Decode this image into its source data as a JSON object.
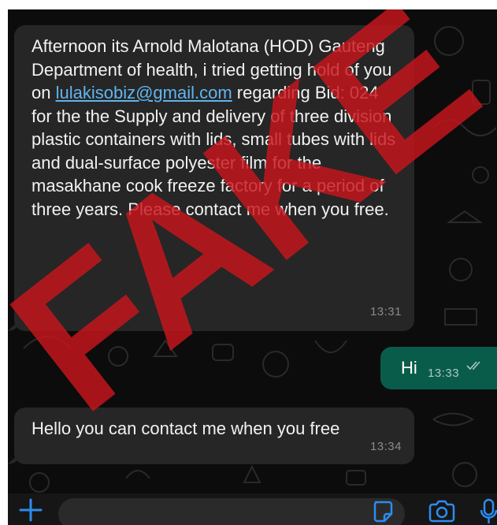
{
  "chat": {
    "messages": [
      {
        "direction": "incoming",
        "text_before_link": "Afternoon its Arnold Malotana (HOD) Gauteng Department of health, i tried getting hold of you on ",
        "link": "lulakisobiz@gmail.com",
        "text_after_link": " regarding Bid: 024 for the the Supply and delivery of three division plastic containers with lids, small tubes with lids and dual-surface polyester film for the masakhane cook freeze factory for a period of three years. Please contact me when you free.",
        "time": "13:31"
      },
      {
        "direction": "outgoing",
        "text": "Hi",
        "time": "13:33",
        "status_icon": "double-check-icon"
      },
      {
        "direction": "incoming",
        "text": "Hello you can contact me when you free",
        "time": "13:34"
      }
    ]
  },
  "overlay": {
    "stamp_text": "FAKE",
    "stamp_color": "#c8161d"
  },
  "composer": {
    "icons": [
      "plus-icon",
      "sticker-icon",
      "camera-icon",
      "mic-icon"
    ],
    "accent_color": "#2d8cf0"
  },
  "colors": {
    "background": "#0c0c0c",
    "incoming_bubble": "#262626",
    "outgoing_bubble": "#0a5c4a",
    "link": "#5fb5f0",
    "timestamp": "#8a8a8a"
  }
}
